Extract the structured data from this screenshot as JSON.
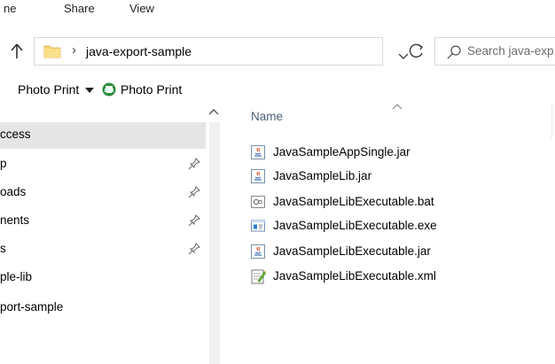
{
  "ribbon": {
    "tabs": [
      "ne",
      "Share",
      "View"
    ]
  },
  "address_bar": {
    "path": "java-export-sample",
    "search_placeholder": "Search java-exp"
  },
  "command_bar": {
    "first_label": "Photo Print",
    "second_label": "Photo Print"
  },
  "nav_pane": {
    "items": [
      {
        "label": "ccess",
        "pinned": false,
        "selected": true
      },
      {
        "label": "p",
        "pinned": true,
        "selected": false
      },
      {
        "label": "oads",
        "pinned": true,
        "selected": false
      },
      {
        "label": "nents",
        "pinned": true,
        "selected": false
      },
      {
        "label": "s",
        "pinned": true,
        "selected": false
      },
      {
        "label": "ple-lib",
        "pinned": false,
        "selected": false
      },
      {
        "label": "port-sample",
        "pinned": false,
        "selected": false
      }
    ]
  },
  "file_list": {
    "column_header": "Name",
    "files": [
      {
        "name": "JavaSampleAppSingle.jar",
        "icon": "jar-file-icon"
      },
      {
        "name": "JavaSampleLib.jar",
        "icon": "jar-file-icon"
      },
      {
        "name": "JavaSampleLibExecutable.bat",
        "icon": "bat-file-icon"
      },
      {
        "name": "JavaSampleLibExecutable.exe",
        "icon": "exe-file-icon"
      },
      {
        "name": "JavaSampleLibExecutable.jar",
        "icon": "jar-file-icon"
      },
      {
        "name": "JavaSampleLibExecutable.xml",
        "icon": "xml-file-icon"
      }
    ]
  },
  "colors": {
    "selected_bg": "#e5e5e5",
    "header_text": "#4c607a",
    "folder_yellow": "#f8d775"
  }
}
